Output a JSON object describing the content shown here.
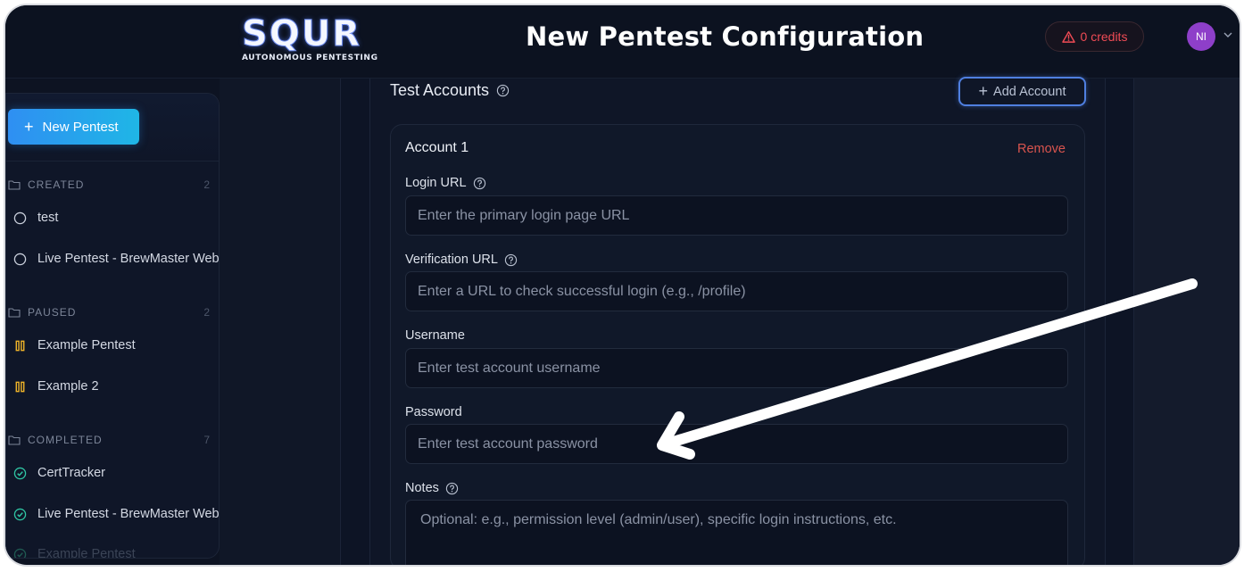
{
  "header": {
    "logo_main": "SQUR",
    "logo_sub": "AUTONOMOUS PENTESTING",
    "title": "New Pentest Configuration",
    "credits_label": "0 credits",
    "avatar_initials": "NI"
  },
  "sidebar": {
    "new_pentest_label": "New Pentest",
    "groups": [
      {
        "label": "CREATED",
        "count": "2",
        "items": [
          {
            "label": "test",
            "status_icon": "circle-icon"
          },
          {
            "label": "Live Pentest - BrewMaster Web",
            "status_icon": "circle-icon"
          }
        ]
      },
      {
        "label": "PAUSED",
        "count": "2",
        "items": [
          {
            "label": "Example Pentest",
            "status_icon": "pause-icon"
          },
          {
            "label": "Example 2",
            "status_icon": "pause-icon"
          }
        ]
      },
      {
        "label": "COMPLETED",
        "count": "7",
        "items": [
          {
            "label": "CertTracker",
            "status_icon": "check-circle-icon"
          },
          {
            "label": "Live Pentest - BrewMaster Web",
            "status_icon": "check-circle-icon"
          },
          {
            "label": "Example Pentest",
            "status_icon": "check-circle-icon"
          }
        ]
      }
    ]
  },
  "section": {
    "title": "Test Accounts",
    "add_account_label": "Add Account"
  },
  "account": {
    "title": "Account 1",
    "remove_label": "Remove",
    "fields": {
      "login_url": {
        "label": "Login URL",
        "placeholder": "Enter the primary login page URL",
        "value": ""
      },
      "verification_url": {
        "label": "Verification URL",
        "placeholder": "Enter a URL to check successful login (e.g., /profile)",
        "value": ""
      },
      "username": {
        "label": "Username",
        "placeholder": "Enter test account username",
        "value": ""
      },
      "password": {
        "label": "Password",
        "placeholder": "Enter test account password",
        "value": ""
      },
      "notes": {
        "label": "Notes",
        "placeholder": "Optional: e.g., permission level (admin/user), specific login instructions, etc.",
        "value": ""
      }
    }
  },
  "colors": {
    "accent_blue": "#2f8ff2",
    "danger_red": "#ef4b55",
    "pause_yellow": "#f0b429",
    "check_teal": "#2fc6a4",
    "avatar_purple": "#8e3fc9"
  }
}
